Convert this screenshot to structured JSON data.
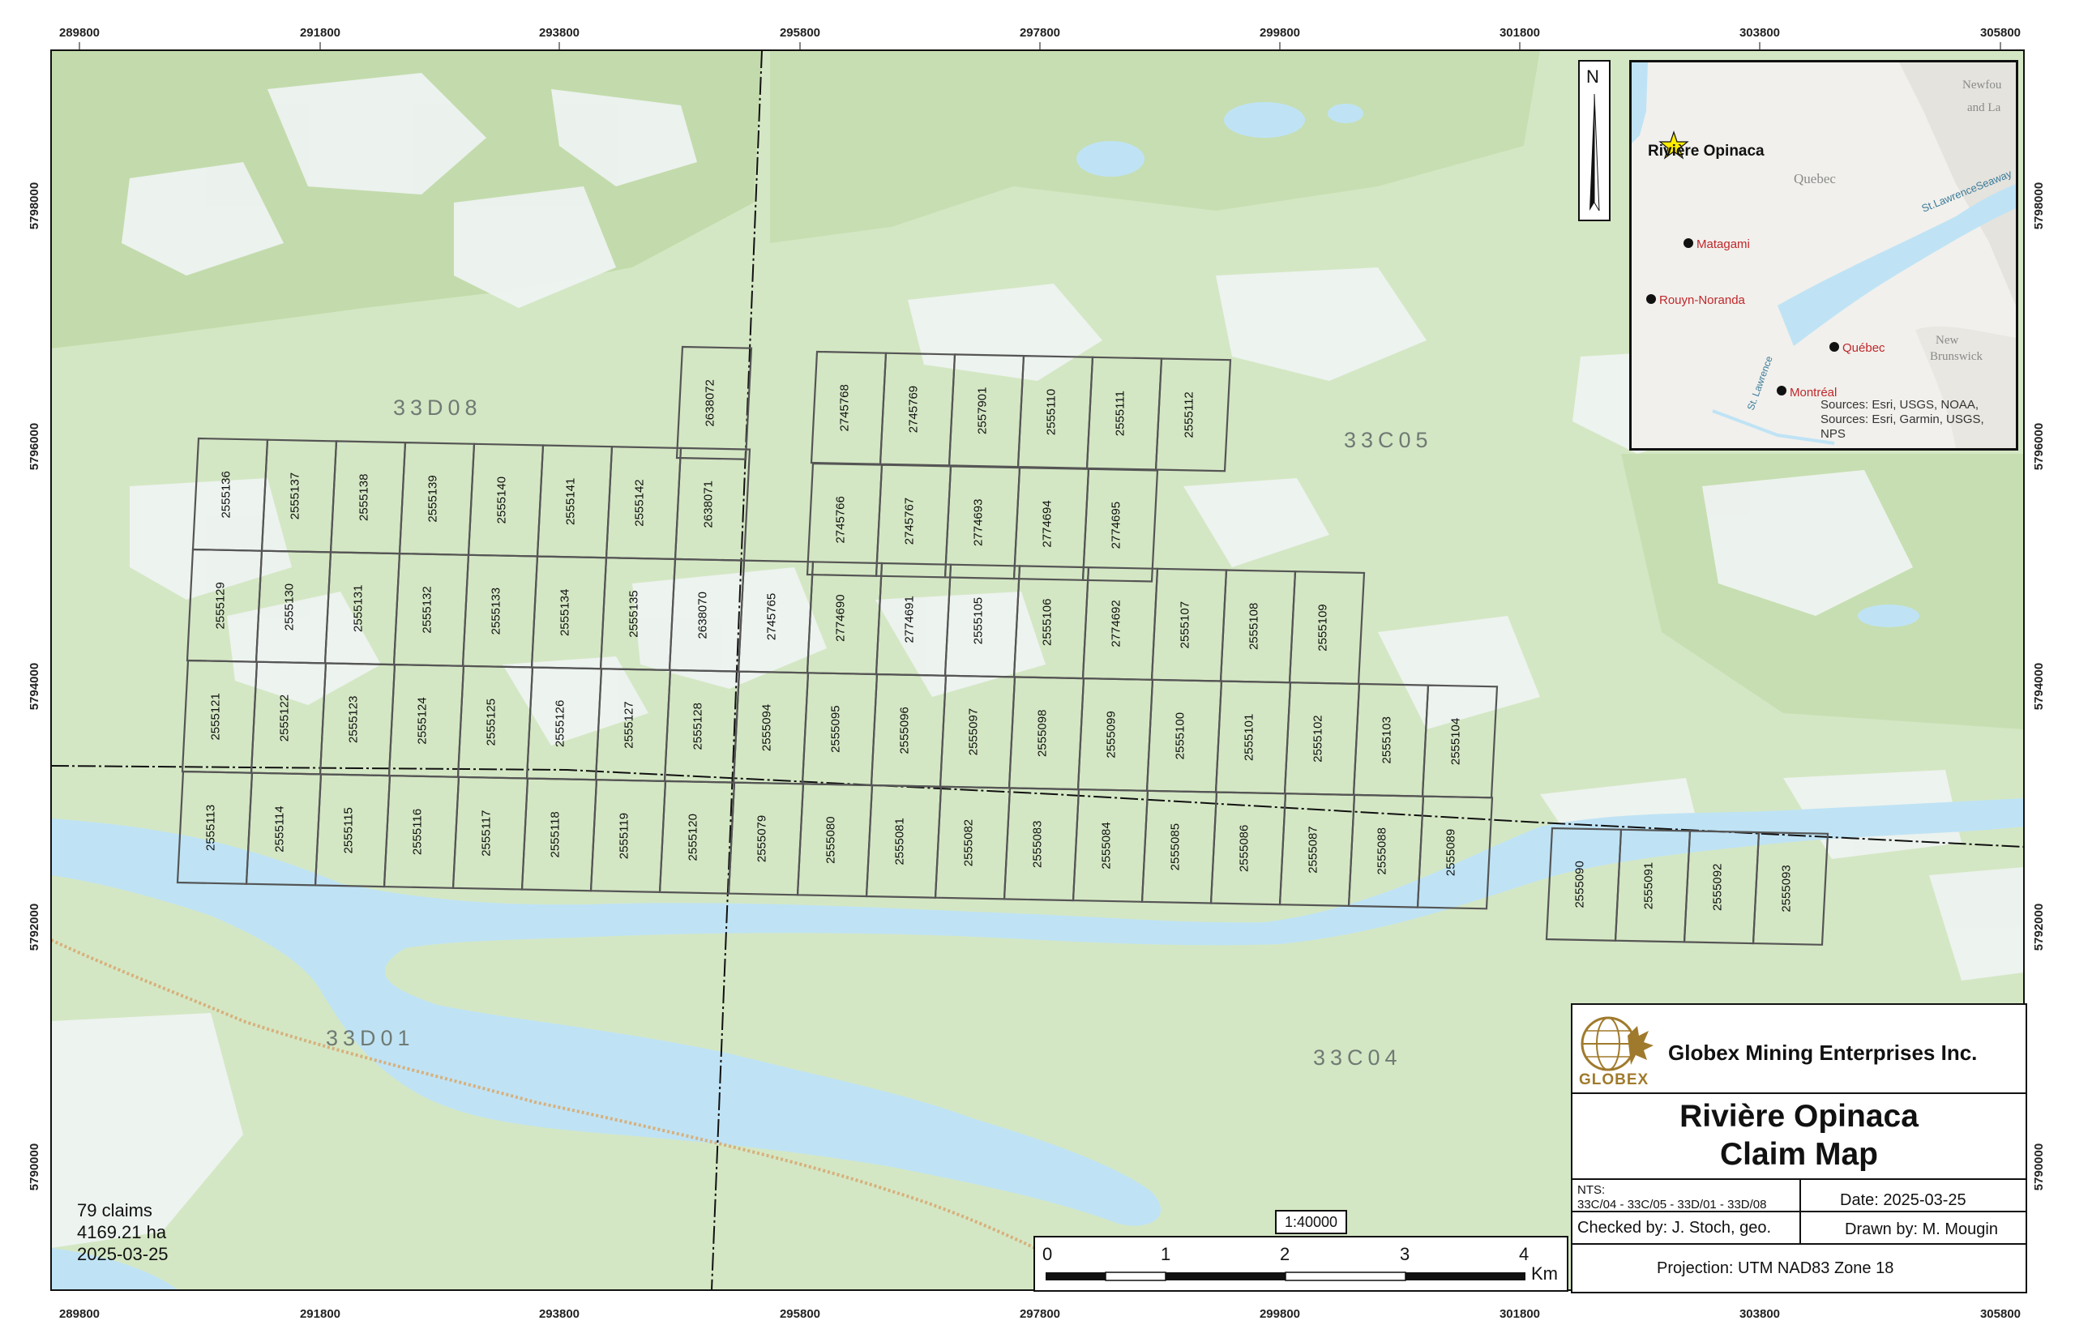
{
  "map": {
    "top_ticks": [
      "289800",
      "291800",
      "293800",
      "295800",
      "297800",
      "299800",
      "301800",
      "303800",
      "305800"
    ],
    "side_ticks": [
      "5798000",
      "5796000",
      "5794000",
      "5792000",
      "5790000"
    ],
    "nts_sheets": [
      "33D08",
      "33C05",
      "33D01",
      "33C04"
    ],
    "claims": {
      "row1_top": [
        "2638072"
      ],
      "row1_east": [
        "2745768",
        "2745769",
        "2557901",
        "2555110",
        "2555111",
        "2555112"
      ],
      "row2_west": [
        "2555136",
        "2555137",
        "2555138",
        "2555139",
        "2555140",
        "2555141",
        "2555142",
        "2638071"
      ],
      "row2_east": [
        "2745766",
        "2745767",
        "2774693",
        "2774694",
        "2774695"
      ],
      "row3": [
        "2555129",
        "2555130",
        "2555131",
        "2555132",
        "2555133",
        "2555134",
        "2555135",
        "2638070",
        "2745765",
        "2774690",
        "2774691",
        "2555105",
        "2555106",
        "2774692",
        "2555107",
        "2555108",
        "2555109"
      ],
      "row4": [
        "2555121",
        "2555122",
        "2555123",
        "2555124",
        "2555125",
        "2555126",
        "2555127",
        "2555128",
        "2555094",
        "2555095",
        "2555096",
        "2555097",
        "2555098",
        "2555099",
        "2555100",
        "2555101",
        "2555102",
        "2555103",
        "2555104"
      ],
      "row5": [
        "2555113",
        "2555114",
        "2555115",
        "2555116",
        "2555117",
        "2555118",
        "2555119",
        "2555120",
        "2555079",
        "2555080",
        "2555081",
        "2555082",
        "2555083",
        "2555084",
        "2555085",
        "2555086",
        "2555087",
        "2555088",
        "2555089"
      ],
      "row5_east": [
        "2555090",
        "2555091",
        "2555092",
        "2555093"
      ]
    },
    "colors": {
      "land": "#d4e7c4",
      "forest": "#c2dcac",
      "water": "#bfe3f5",
      "wetland": "#e4eef0",
      "claim_line": "#555555"
    }
  },
  "stats": {
    "claims": "79 claims",
    "area": "4169.21 ha",
    "date": "2025-03-25"
  },
  "north": {
    "label": "N"
  },
  "inset": {
    "project": "Rivière Opinaca",
    "cities": [
      "Matagami",
      "Rouyn-Noranda",
      "Québec",
      "Montréal"
    ],
    "places": [
      "Newfou",
      "and La",
      "Quebec",
      "New",
      "Brunswick"
    ],
    "seaway": "St.LawrenceSeaway",
    "river": "St. Lawrence",
    "sources": [
      "Sources: Esri, USGS, NOAA,",
      "Sources: Esri, Garmin, USGS,",
      "NPS"
    ]
  },
  "titleblock": {
    "company": "Globex Mining Enterprises Inc.",
    "logo": "GLOBEX",
    "title1": "Rivière Opinaca",
    "title2": "Claim Map",
    "nts_label": "NTS:",
    "nts_value": "33C/04 - 33C/05 - 33D/01 - 33D/08",
    "date": "Date: 2025-03-25",
    "checked": "Checked by: J. Stoch, geo.",
    "drawn": "Drawn by: M. Mougin",
    "projection": "Projection: UTM NAD83 Zone 18"
  },
  "scale": {
    "ratio": "1:40000",
    "labels": [
      "0",
      "1",
      "2",
      "3",
      "4"
    ],
    "unit": "Km"
  }
}
